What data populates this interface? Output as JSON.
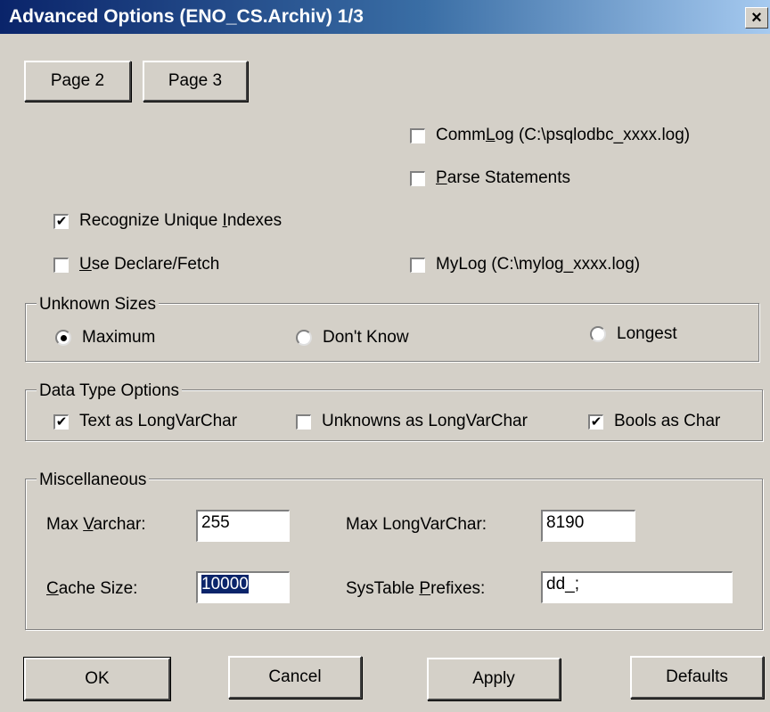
{
  "window": {
    "title": "Advanced Options (ENO_CS.Archiv) 1/3",
    "close_glyph": "×"
  },
  "page_buttons": {
    "page2": "Page 2",
    "page3": "Page 3"
  },
  "options": {
    "commlog": {
      "pre": "Comm",
      "ul": "L",
      "post": "og (C:\\psqlodbc_xxxx.log)",
      "checked": false
    },
    "parse": {
      "pre": "",
      "ul": "P",
      "post": "arse Statements",
      "checked": false
    },
    "unique": {
      "pre": "Recognize Unique ",
      "ul": "I",
      "post": "ndexes",
      "checked": true
    },
    "declare": {
      "pre": "",
      "ul": "U",
      "post": "se Declare/Fetch",
      "checked": false
    },
    "mylog": {
      "pre": "",
      "ul": "",
      "post": "MyLog (C:\\mylog_xxxx.log)",
      "checked": false
    }
  },
  "unknown_sizes": {
    "legend": "Unknown Sizes",
    "maximum": "Maximum",
    "dontknow": "Don't Know",
    "longest": "Longest",
    "selected": "maximum"
  },
  "data_type_options": {
    "legend": "Data Type Options",
    "text_longvarchar": {
      "label": "Text as LongVarChar",
      "checked": true
    },
    "unknowns_longvarchar": {
      "label": "Unknowns as LongVarChar",
      "checked": false
    },
    "bools_char": {
      "label": "Bools as Char",
      "checked": true
    }
  },
  "misc": {
    "legend": "Miscellaneous",
    "max_varchar": {
      "pre": "Max ",
      "ul": "V",
      "post": "archar:",
      "value": "255"
    },
    "max_longvarchar": {
      "label": "Max LongVarChar:",
      "value": "8190"
    },
    "cache_size": {
      "pre": "",
      "ul": "C",
      "post": "ache Size:",
      "value": "10000"
    },
    "systable_prefixes": {
      "pre": "SysTable ",
      "ul": "P",
      "post": "refixes:",
      "value": "dd_;"
    }
  },
  "buttons": {
    "ok": "OK",
    "cancel": "Cancel",
    "apply": "Apply",
    "defaults": "Defaults"
  },
  "check_glyph": "✔"
}
